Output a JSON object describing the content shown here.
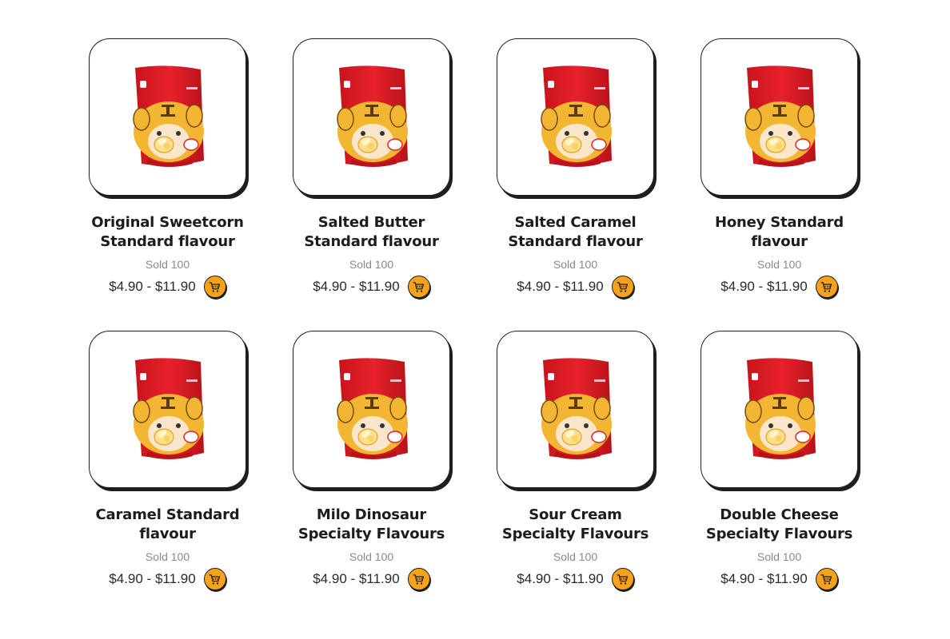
{
  "products": [
    {
      "name": "Original Sweetcorn Standard flavour",
      "sold": "Sold 100",
      "price": "$4.90 - $11.90",
      "cart_icon": "cart-icon",
      "image": "popcorn-pouch-image"
    },
    {
      "name": "Salted Butter Standard flavour",
      "sold": "Sold 100",
      "price": "$4.90 - $11.90",
      "cart_icon": "cart-icon",
      "image": "popcorn-pouch-image"
    },
    {
      "name": "Salted Caramel Standard flavour",
      "sold": "Sold 100",
      "price": "$4.90 - $11.90",
      "cart_icon": "cart-icon",
      "image": "popcorn-pouch-image"
    },
    {
      "name": "Honey Standard flavour",
      "sold": "Sold 100",
      "price": "$4.90 - $11.90",
      "cart_icon": "cart-icon",
      "image": "popcorn-pouch-image"
    },
    {
      "name": "Caramel Standard flavour",
      "sold": "Sold 100",
      "price": "$4.90 - $11.90",
      "cart_icon": "cart-icon",
      "image": "popcorn-pouch-image"
    },
    {
      "name": "Milo Dinosaur Specialty Flavours",
      "sold": "Sold 100",
      "price": "$4.90 - $11.90",
      "cart_icon": "cart-icon",
      "image": "popcorn-pouch-image"
    },
    {
      "name": "Sour Cream Specialty Flavours",
      "sold": "Sold 100",
      "price": "$4.90 - $11.90",
      "cart_icon": "cart-icon",
      "image": "popcorn-pouch-image"
    },
    {
      "name": "Double Cheese Specialty Flavours",
      "sold": "Sold 100",
      "price": "$4.90 - $11.90",
      "cart_icon": "cart-icon",
      "image": "popcorn-pouch-image"
    }
  ],
  "colors": {
    "cart_button": "#f7a21b",
    "pouch_red": "#e8212b",
    "mascot_yellow": "#f2b632",
    "card_border": "#1e1e1e"
  }
}
